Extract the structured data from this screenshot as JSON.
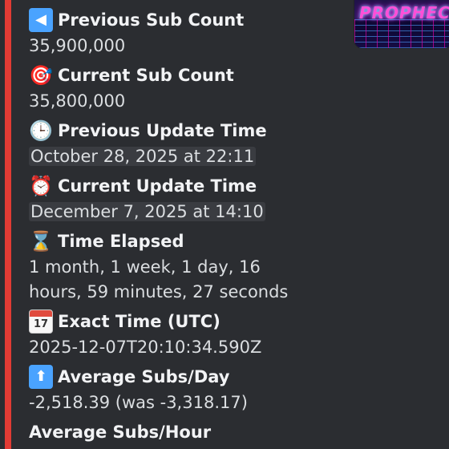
{
  "thumbnail": {
    "text": "PROPHECY"
  },
  "fields": [
    {
      "icon": "left-arrow-icon",
      "name": "Previous Sub Count",
      "value": "35,900,000"
    },
    {
      "icon": "target-icon",
      "name": "Current Sub Count",
      "value": "35,800,000"
    },
    {
      "icon": "clock-icon",
      "name": "Previous Update Time",
      "value": "October 28, 2025 at 22:11"
    },
    {
      "icon": "alarm-clock-icon",
      "name": "Current Update Time",
      "value": "December 7, 2025 at 14:10"
    },
    {
      "icon": "hourglass-icon",
      "name": "Time Elapsed",
      "value": "1 month, 1 week, 1 day, 16 hours, 59 minutes, 27 seconds"
    },
    {
      "icon": "calendar-icon",
      "name": "Exact Time (UTC)",
      "value": "2025-12-07T20:10:34.590Z"
    },
    {
      "icon": "up-arrow-icon",
      "name": "Average Subs/Day",
      "value": "-2,518.39 (was -3,318.17)"
    },
    {
      "name": "Average Subs/Hour"
    }
  ],
  "calendar_day": "17",
  "colors": {
    "accent": "#e23b34",
    "background": "#2b2d31"
  }
}
